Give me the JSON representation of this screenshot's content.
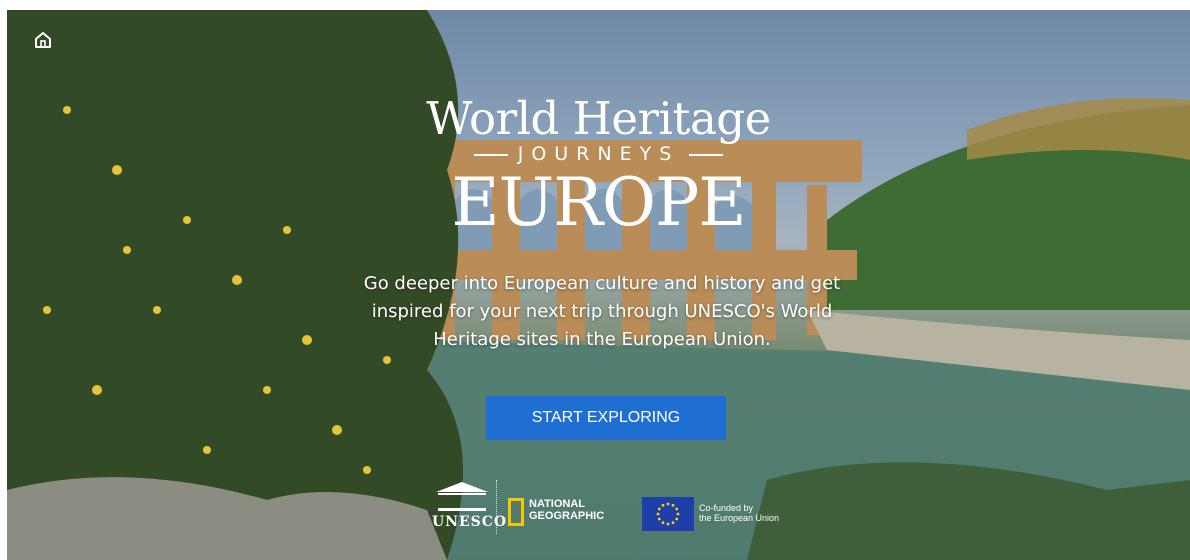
{
  "nav": {
    "home_icon": "home-icon"
  },
  "logo": {
    "line1": "World Heritage",
    "line2": "JOURNEYS",
    "line3": "EUROPE"
  },
  "description": "Go deeper into European culture and history and get inspired for your next trip through UNESCO's World Heritage sites in the European Union.",
  "cta": {
    "label": "START EXPLORING",
    "color": "#1f6fd3"
  },
  "partners": {
    "unesco": "UNESCO",
    "natgeo": [
      "NATIONAL",
      "GEOGRAPHIC"
    ],
    "eu": [
      "Co-funded by",
      "the European Union"
    ]
  }
}
